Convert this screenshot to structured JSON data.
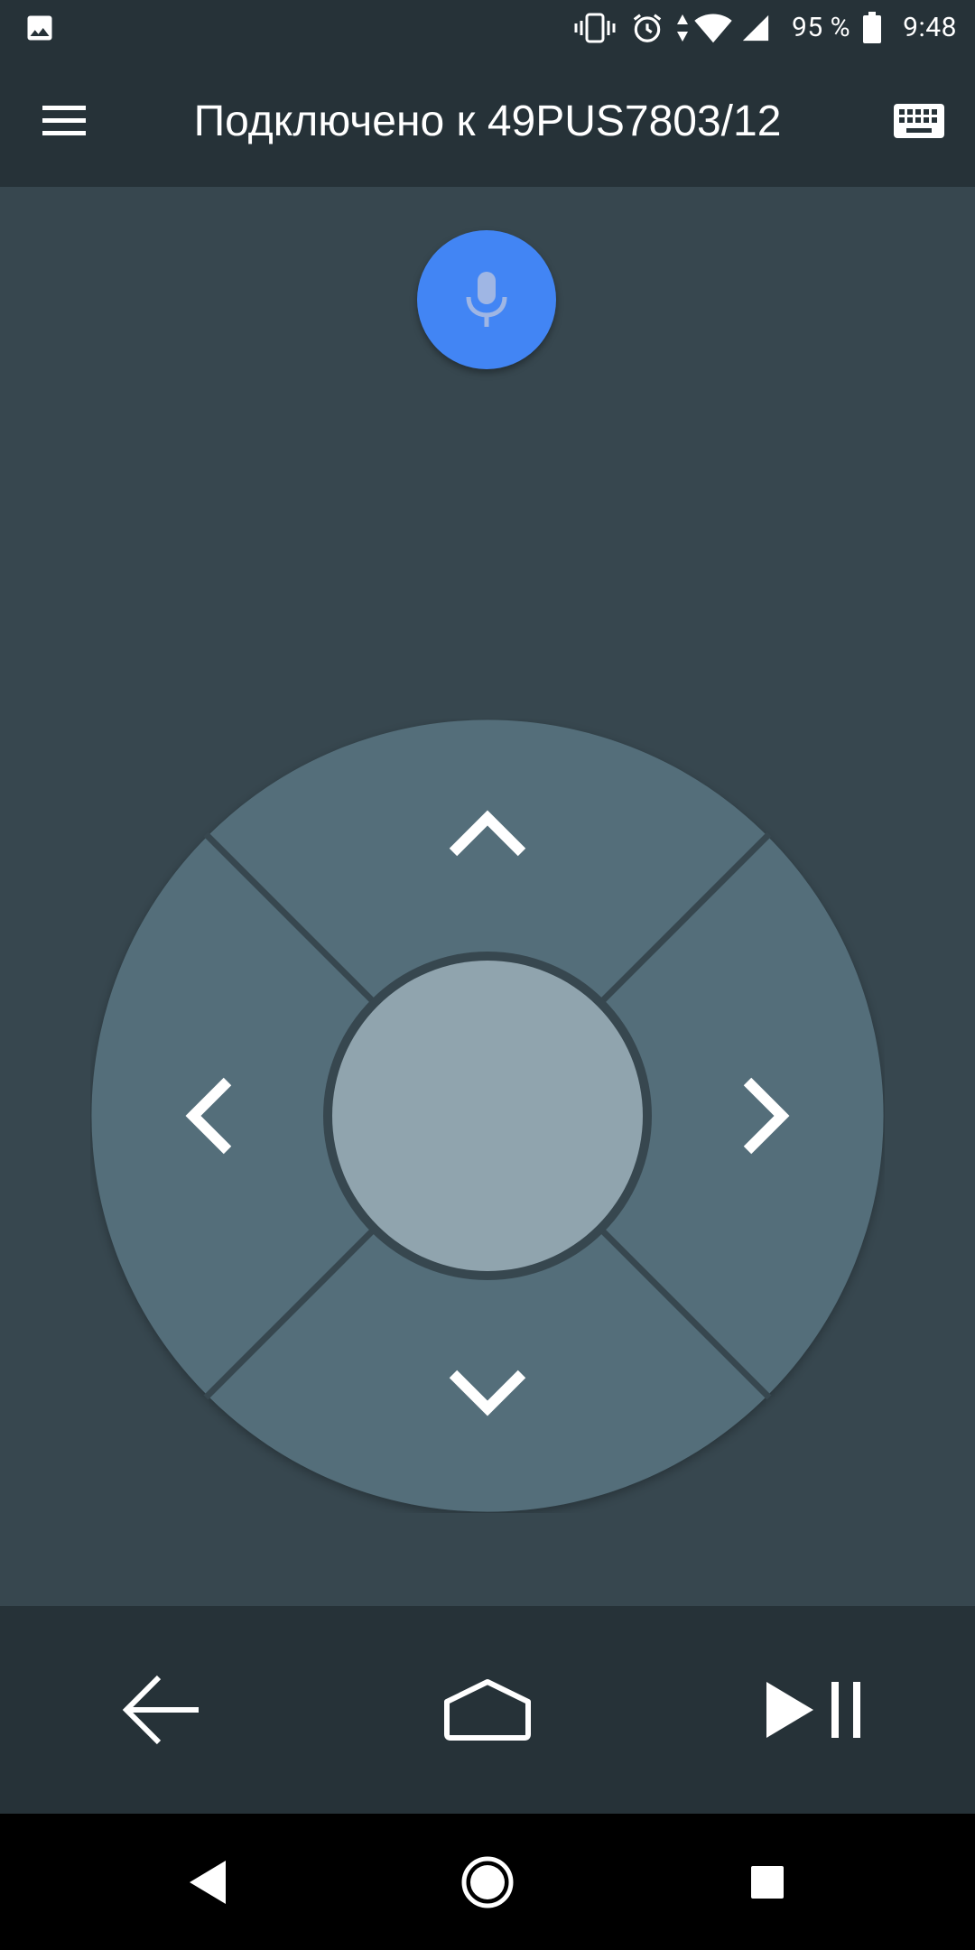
{
  "status_bar": {
    "left_icon": "image-icon",
    "icons": [
      "vibrate-icon",
      "alarm-icon",
      "data-arrows-icon",
      "wifi-icon",
      "cellular-signal-icon"
    ],
    "battery_percent": "95 %",
    "battery_icon": "battery-icon",
    "time": "9:48"
  },
  "app_bar": {
    "title": "Подключено к 49PUS7803/12",
    "menu_icon": "hamburger-menu-icon",
    "keyboard_icon": "keyboard-icon"
  },
  "remote": {
    "voice_icon": "microphone-icon",
    "dpad": {
      "up_icon": "chevron-up-icon",
      "down_icon": "chevron-down-icon",
      "left_icon": "chevron-left-icon",
      "right_icon": "chevron-right-icon",
      "center": "ok-center-button"
    }
  },
  "media_bar": {
    "back_icon": "arrow-back-icon",
    "home_icon": "home-icon",
    "play_pause_icon": "play-pause-icon"
  },
  "nav_bar": {
    "back_icon": "triangle-back-icon",
    "home_icon": "circle-home-icon",
    "recents_icon": "square-recents-icon"
  },
  "colors": {
    "app_bar": "#263238",
    "background": "#37474f",
    "dpad_segment": "#546e7a",
    "dpad_center": "#90a4ae",
    "mic_accent": "#4285f4",
    "nav_bar": "#000000"
  }
}
